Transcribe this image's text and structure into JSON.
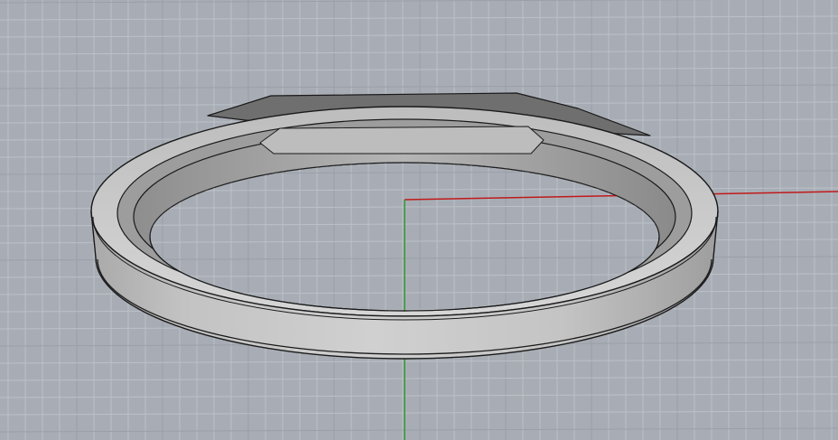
{
  "viewport": {
    "label": "",
    "background": "#a8adb5",
    "grid_minor_color": "#bcc1c8",
    "grid_major_color": "#9aa0a8",
    "x_axis_color": "#c01a1a",
    "y_axis_color": "#2e9a2e"
  },
  "model": {
    "name": "ring",
    "body_color": "#c6c6c6",
    "shadow_color": "#8c8c8c",
    "edge_color": "#1a1a1a"
  }
}
